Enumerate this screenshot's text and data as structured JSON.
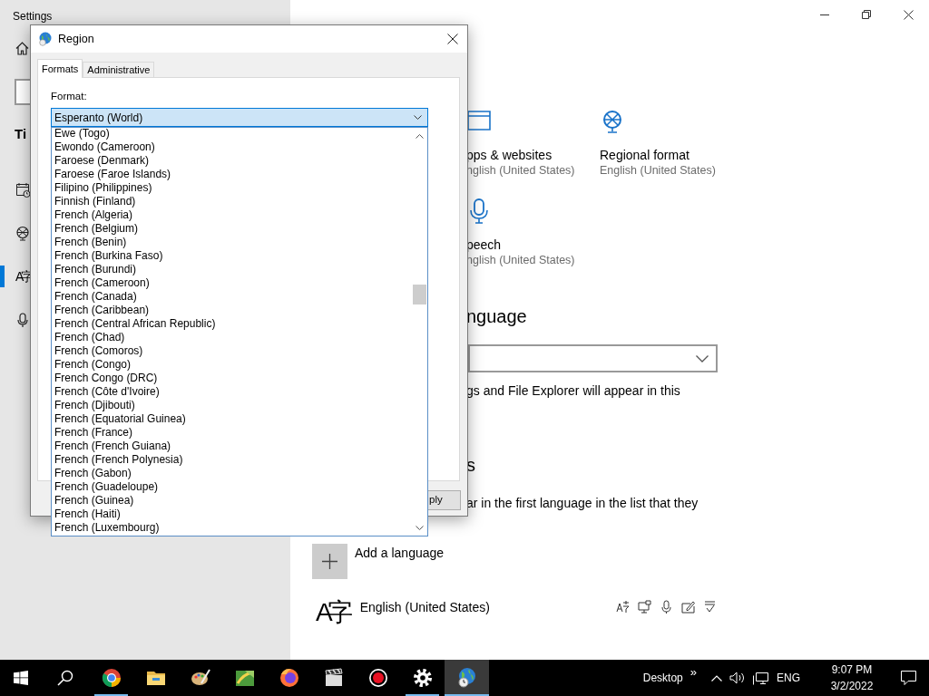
{
  "settings_window": {
    "title": "Settings",
    "section_heading": "Ti",
    "sidebar_items": [
      {
        "kind": "date-time",
        "selected": false
      },
      {
        "kind": "region",
        "selected": false
      },
      {
        "kind": "language",
        "glyph": "A字",
        "selected": true
      },
      {
        "kind": "speech",
        "selected": false
      }
    ],
    "tiles": [
      {
        "kind": "window",
        "title": "pps & websites",
        "subtitle": "nglish (United States)"
      },
      {
        "kind": "globe",
        "title": "Regional format",
        "subtitle": "English (United States)"
      },
      {
        "kind": "mic",
        "title": "peech",
        "subtitle": "nglish (United States)"
      }
    ],
    "language_heading": "nguage",
    "language_note": "gs and File Explorer will appear in this",
    "preferred_heading": "s",
    "preferred_note": "ar in the first language in the list that they",
    "add_language": "Add a language",
    "languages": [
      {
        "glyph": "A字",
        "name": "English (United States)"
      }
    ]
  },
  "region_dialog": {
    "title": "Region",
    "tabs": [
      {
        "label": "Formats",
        "selected": true
      },
      {
        "label": "Administrative",
        "selected": false
      }
    ],
    "format_label": "Format:",
    "format_value": "Esperanto (World)",
    "format_options": [
      "Ewe (Togo)",
      "Ewondo (Cameroon)",
      "Faroese (Denmark)",
      "Faroese (Faroe Islands)",
      "Filipino (Philippines)",
      "Finnish (Finland)",
      "French (Algeria)",
      "French (Belgium)",
      "French (Benin)",
      "French (Burkina Faso)",
      "French (Burundi)",
      "French (Cameroon)",
      "French (Canada)",
      "French (Caribbean)",
      "French (Central African Republic)",
      "French (Chad)",
      "French (Comoros)",
      "French (Congo)",
      "French Congo (DRC)",
      "French (Côte d'Ivoire)",
      "French (Djibouti)",
      "French (Equatorial Guinea)",
      "French (France)",
      "French (French Guiana)",
      "French (French Polynesia)",
      "French (Gabon)",
      "French (Guadeloupe)",
      "French (Guinea)",
      "French (Haiti)",
      "French (Luxembourg)"
    ],
    "apply_button": "ply"
  },
  "taskbar": {
    "apps": [
      {
        "kind": "chrome",
        "running": true,
        "selected": false
      },
      {
        "kind": "files",
        "running": false,
        "selected": false
      },
      {
        "kind": "paint",
        "running": false,
        "selected": false
      },
      {
        "kind": "map",
        "running": false,
        "selected": false
      },
      {
        "kind": "firefox",
        "running": false,
        "selected": false
      },
      {
        "kind": "clapper",
        "running": false,
        "selected": false
      },
      {
        "kind": "record",
        "running": false,
        "selected": false
      },
      {
        "kind": "gear",
        "running": true,
        "selected": false
      },
      {
        "kind": "globe",
        "running": true,
        "selected": true
      }
    ],
    "desktop_label": "Desktop",
    "overflow": "»",
    "language": "ENG",
    "time": "9:07 PM",
    "date": "3/2/2022"
  }
}
